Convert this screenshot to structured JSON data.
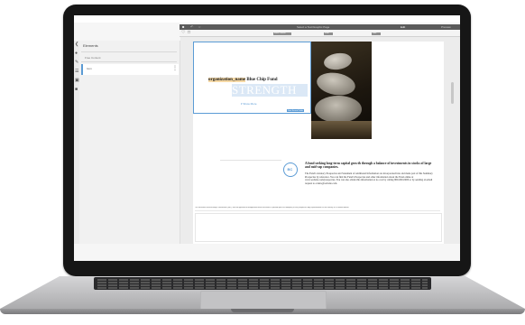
{
  "sidebar": {
    "title": "Elements",
    "group": "Free Content",
    "item": "Icon"
  },
  "toolbar": {
    "center_text": "Select a Text/Graphic Page",
    "right_text_1": "Edit",
    "right_text_2": "Preview",
    "chip_left": "Insert Content",
    "chip_mid": "Form",
    "chip_right": "Data"
  },
  "document": {
    "fund_placeholder": "organization_name",
    "fund_name": "Blue Chip Fund",
    "banner_word": "STRENGTH",
    "show_more": "Show More",
    "help_tag": "Data Source Fields",
    "circle_label": "BC",
    "headline": "A fund seeking long-term capital growth through a balance of investments in stocks of large and mid-cap companies.",
    "body": "The Fund's statutory Prospectus and Statement of Additional Information are incorporated into and made part of this Summary Prospectus by reference. You can find the Fund's Prospectus and other information about the Fund online at www.website.com/prospectus. You can also obtain this information at no cost by calling 800-000-0000 or by sending an email request to orders@website.com.",
    "footer": "The Securities and Exchange Commission (SEC) has not approved or disapproved these securities or passed upon the adequacy of this prospectus. Any representation to the contrary is a criminal offense."
  },
  "colors": {
    "accent": "#5b9bd5",
    "dark_toolbar": "#5b5b5b",
    "highlight": "#f6d9a5"
  }
}
